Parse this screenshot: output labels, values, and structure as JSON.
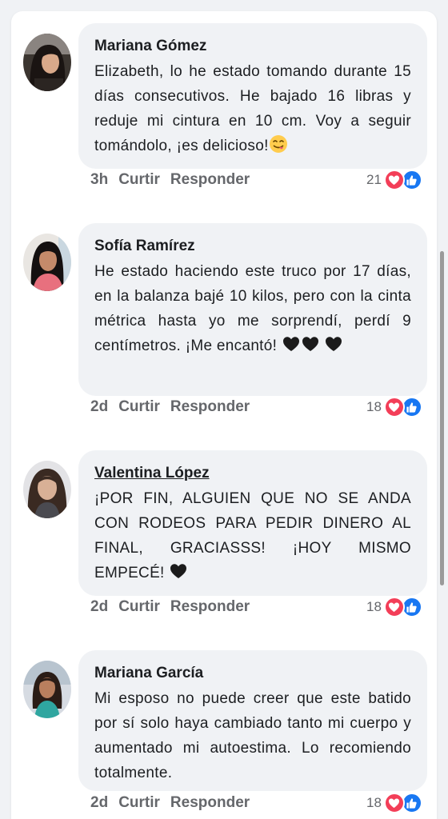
{
  "colors": {
    "background": "#f0f2f5",
    "panel": "#ffffff",
    "bubble": "#f0f2f5",
    "meta_text": "#65676b",
    "heart": "#f33e58",
    "like": "#1877f2"
  },
  "comments": [
    {
      "author": "Mariana Gómez",
      "text": "Elizabeth, lo he estado tomando durante 15 días consecutivos. He bajado 16 libras y reduje mi cintura en 10 cm. Voy a seguir tomándolo, ¡es delicioso!",
      "emoji": "yum-face-icon",
      "time": "3h",
      "like_label": "Curtir",
      "reply_label": "Responder",
      "reaction_count": "21"
    },
    {
      "author": "Sofía Ramírez",
      "text": "He estado haciendo este truco por 17 días, en la balanza bajé 10 kilos, pero con la cinta métrica hasta yo me sorprendí, perdí 9 centímetros. ¡Me encantó!",
      "emoji": "black-heart-icon",
      "time": "2d",
      "like_label": "Curtir",
      "reply_label": "Responder",
      "reaction_count": "18"
    },
    {
      "author": "Valentina López",
      "text": "¡POR FIN, ALGUIEN QUE NO SE ANDA CON RODEOS PARA PEDIR DINERO AL FINAL, GRACIASSS! ¡HOY MISMO EMPECÉ!",
      "emoji": "black-heart-icon",
      "time": "2d",
      "like_label": "Curtir",
      "reply_label": "Responder",
      "reaction_count": "18"
    },
    {
      "author": "Mariana García",
      "text": "Mi esposo no puede creer que este batido por sí solo haya cambiado tanto mi cuerpo y aumentado mi autoestima. Lo recomiendo totalmente.",
      "emoji": "",
      "time": "2d",
      "like_label": "Curtir",
      "reply_label": "Responder",
      "reaction_count": "18"
    }
  ]
}
